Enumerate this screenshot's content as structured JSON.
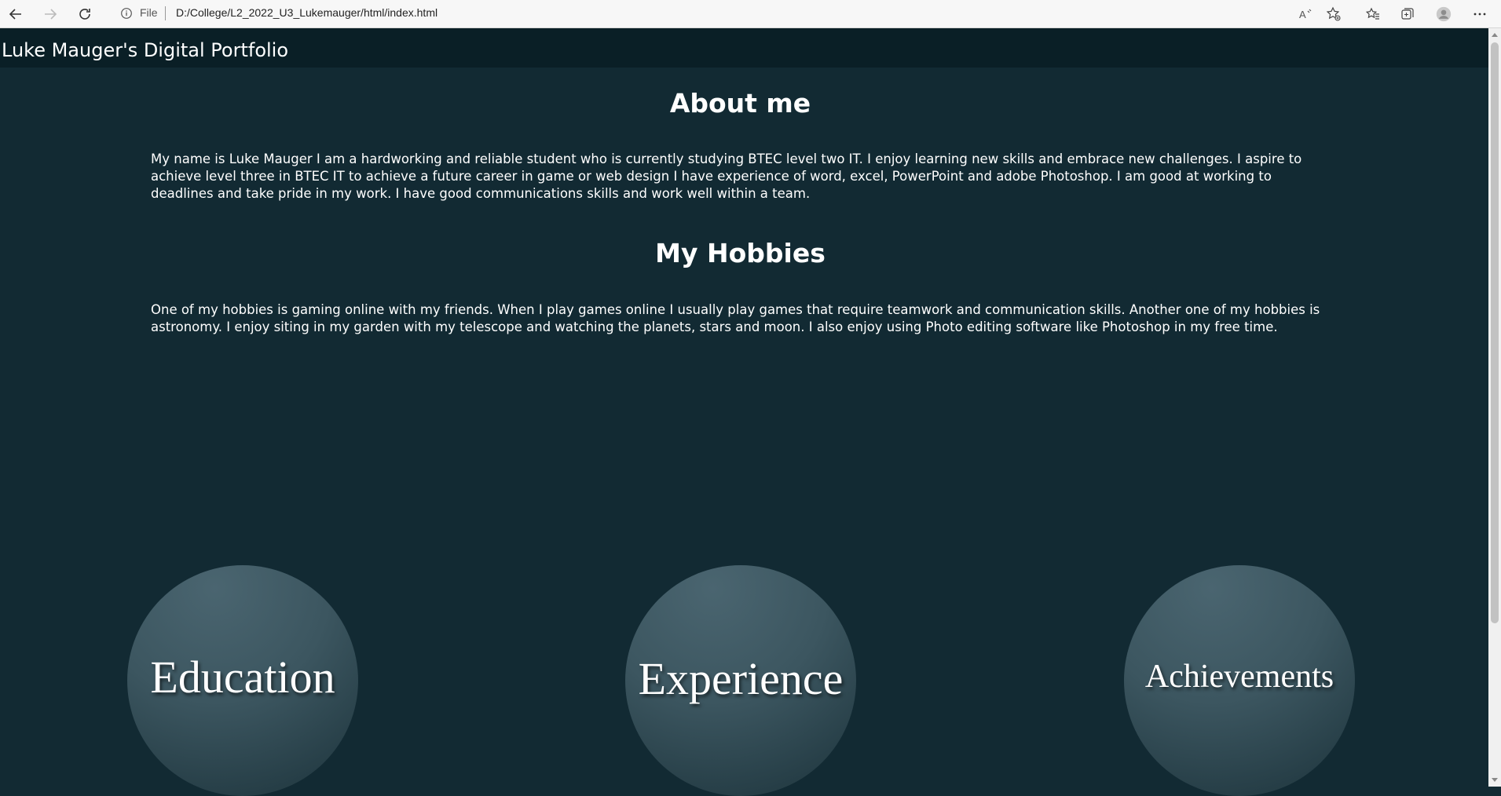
{
  "browser": {
    "address_scheme": "File",
    "address_url": "D:/College/L2_2022_U3_Lukemauger/html/index.html",
    "icons": [
      "back-icon",
      "forward-icon",
      "refresh-icon",
      "info-icon",
      "read-aloud-icon",
      "add-favorite-icon",
      "favorites-icon",
      "collections-icon",
      "profile-icon",
      "more-icon"
    ]
  },
  "site": {
    "title": "Luke Mauger's Digital Portfolio"
  },
  "about": {
    "heading": "About me",
    "text": "My name is Luke Mauger I am a hardworking and reliable student who is currently studying BTEC level two IT. I enjoy learning new skills and embrace new challenges. I aspire to achieve level three in BTEC IT to achieve a future career in game or web design I have experience of word, excel, PowerPoint and adobe Photoshop. I am good at working to deadlines and take pride in my work. I have good communications skills and work well within a team."
  },
  "hobbies": {
    "heading": "My Hobbies",
    "text": "One of my hobbies is gaming online with my friends. When I play games online I usually play games that require teamwork and communication skills. Another one of my hobbies is astronomy. I enjoy siting in my garden with my telescope and watching the planets, stars and moon. I also enjoy using Photo editing software like Photoshop in my free time."
  },
  "nav_circles": {
    "education": "Education",
    "experience": "Experience",
    "achievements": "Achievements"
  },
  "colors": {
    "page_background": "#122a33",
    "header_background": "#0a1f26",
    "circle_fill": "#3c5660"
  }
}
